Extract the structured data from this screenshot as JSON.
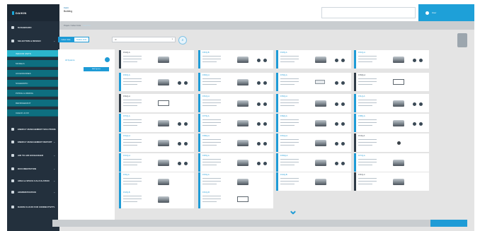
{
  "brand": {
    "logo_text": "DAIKIN",
    "accent": "#1e9bd6",
    "sidebar_bg": "#23303d",
    "sidebar_active": "#2bb5cc"
  },
  "header": {
    "project_label": "Daikin",
    "project_name": "Building",
    "user_name": "User"
  },
  "breadcrumb": {
    "path": "Project  /  Indoor Units",
    "current": "Selection"
  },
  "sidebar": {
    "items": [
      {
        "label": "DASHBOARD",
        "icon": "home-icon"
      },
      {
        "label": "SELECTION & DESIGN",
        "icon": "layers-icon",
        "expanded": true
      },
      {
        "label": "INDOOR UNITS",
        "icon": "",
        "active": true
      },
      {
        "label": "MODELS",
        "icon": ""
      },
      {
        "label": "ACCESSORIES",
        "icon": ""
      },
      {
        "label": "SCHEMATIC",
        "icon": ""
      },
      {
        "label": "PIPING & WIRING",
        "icon": ""
      },
      {
        "label": "REFRIGERANT",
        "icon": ""
      },
      {
        "label": "CHECK & FIX",
        "icon": ""
      },
      {
        "label": "ENERGY MANAGEMENT SOLUTIONS",
        "icon": "leaf-icon"
      },
      {
        "label": "ENERGY MANAGEMENT REPORT",
        "icon": "chart-icon"
      },
      {
        "label": "AIR TO AIR EXCHANGER",
        "icon": "fan-icon"
      },
      {
        "label": "DOCUMENTATION",
        "icon": "document-icon"
      },
      {
        "label": "AREA & SPACE CALCULATION",
        "icon": "ruler-icon"
      },
      {
        "label": "ADMINISTRATION",
        "icon": "settings-icon"
      },
      {
        "label": "DAIKIN CLOUD FOR CONNECTIVITY",
        "icon": ""
      }
    ]
  },
  "controls": {
    "tab_1": "Indoor Units",
    "tab_2": "Outdoor Units",
    "filter_placeholder": "All",
    "search_icon": "search-icon"
  },
  "left_panel": {
    "label": "All Systems",
    "button": "Add System"
  },
  "products": [
    {
      "name": "FXAQ-A",
      "variant": "dark",
      "img": "unit",
      "icons": false
    },
    {
      "name": "FXFQ-B",
      "variant": "blue",
      "img": "unit",
      "icons": true
    },
    {
      "name": "FXZQ-A",
      "variant": "blue",
      "img": "unit",
      "icons": true
    },
    {
      "name": "FXCQ-A",
      "variant": "blue",
      "img": "unit",
      "icons": true
    },
    {
      "name": "FXKQ-A",
      "variant": "blue",
      "img": "unit",
      "icons": true
    },
    {
      "name": "FXDQ-A",
      "variant": "blue",
      "img": "unit",
      "icons": true
    },
    {
      "name": "FXSQ-A",
      "variant": "blue",
      "img": "hang",
      "icons": true
    },
    {
      "name": "FXMQ-A",
      "variant": "dark",
      "img": "flat",
      "icons": false
    },
    {
      "name": "FXHQ-A",
      "variant": "dark",
      "img": "flat",
      "icons": false
    },
    {
      "name": "FXUQ-A",
      "variant": "blue",
      "img": "unit",
      "icons": true
    },
    {
      "name": "FXNQ-A",
      "variant": "blue",
      "img": "unit",
      "icons": true
    },
    {
      "name": "FXLQ-A",
      "variant": "blue",
      "img": "unit",
      "icons": true
    },
    {
      "name": "FXVQ-A",
      "variant": "blue",
      "img": "unit",
      "icons": true
    },
    {
      "name": "FXTQ-A",
      "variant": "blue",
      "img": "unit",
      "icons": true
    },
    {
      "name": "FXEQ-A",
      "variant": "blue",
      "img": "unit",
      "icons": true
    },
    {
      "name": "FXBQ-A",
      "variant": "blue",
      "img": "unit",
      "icons": true
    },
    {
      "name": "FXQQ-A",
      "variant": "blue",
      "img": "unit",
      "icons": true
    },
    {
      "name": "FXRQ-A",
      "variant": "blue",
      "img": "unit",
      "icons": true
    },
    {
      "name": "FXGQ-A",
      "variant": "blue",
      "img": "unit",
      "icons": true
    },
    {
      "name": "FXJQ-A",
      "variant": "dark",
      "img": "dot",
      "icons": false
    },
    {
      "name": "FXOQ-A",
      "variant": "blue",
      "img": "unit",
      "icons": true
    },
    {
      "name": "FXPQ-A",
      "variant": "blue",
      "img": "unit",
      "icons": true
    },
    {
      "name": "FXWQ-A",
      "variant": "blue",
      "img": "unit",
      "icons": true
    },
    {
      "name": "FXYQ-A",
      "variant": "blue",
      "img": "unit",
      "icons": false
    },
    {
      "name": "FXIQ-A",
      "variant": "blue",
      "img": "unit",
      "icons": false
    },
    {
      "name": "FXXQ-A",
      "variant": "blue",
      "img": "unit",
      "icons": false
    },
    {
      "name": "FXAQ-B",
      "variant": "blue",
      "img": "unit",
      "icons": false
    },
    {
      "name": "FXFQ-C",
      "variant": "dark",
      "img": "unit",
      "icons": false
    },
    {
      "name": "FXZQ-B",
      "variant": "blue",
      "img": "unit",
      "icons": false
    },
    {
      "name": "FXCQ-B",
      "variant": "blue",
      "img": "flat",
      "icons": false
    }
  ],
  "footer": {
    "button": ""
  }
}
